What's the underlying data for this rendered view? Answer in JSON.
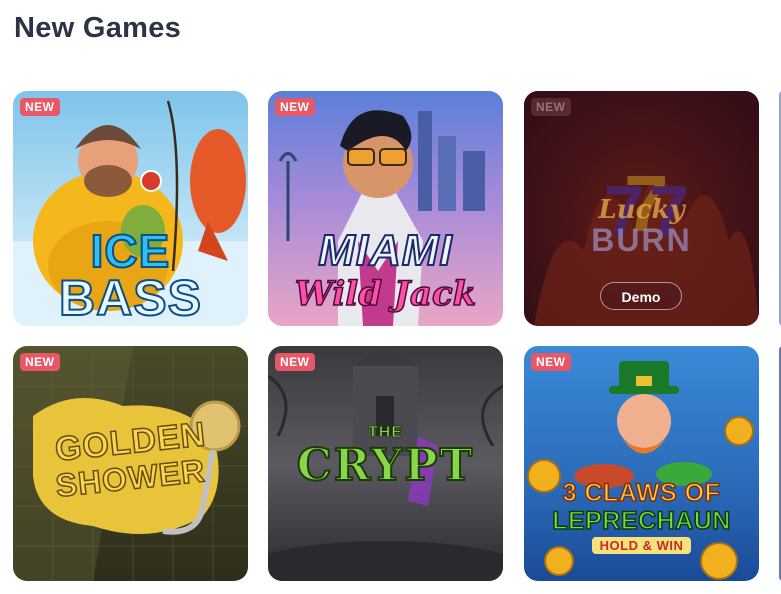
{
  "section": {
    "title": "New Games"
  },
  "colors": {
    "title": "#2b3445",
    "badge": "#e85766"
  },
  "games": [
    {
      "title_line1": "ICE",
      "title_line2": "BASS",
      "badge": "NEW"
    },
    {
      "title_line1": "MIAMI",
      "title_line2": "Wild Jack",
      "badge": "NEW"
    },
    {
      "title_line1": "Lucky",
      "title_line2": "BURN",
      "badge": "NEW",
      "button": "Demo"
    },
    {
      "title_line1": "GOLDEN",
      "title_line2": "SHOWER",
      "badge": "NEW"
    },
    {
      "title_line1": "THE",
      "title_line2": "CRYPT",
      "badge": "NEW"
    },
    {
      "title_line1": "3 CLAWS OF",
      "title_line2": "LEPRECHAUN",
      "title_line3": "HOLD & WIN",
      "badge": "NEW"
    }
  ]
}
